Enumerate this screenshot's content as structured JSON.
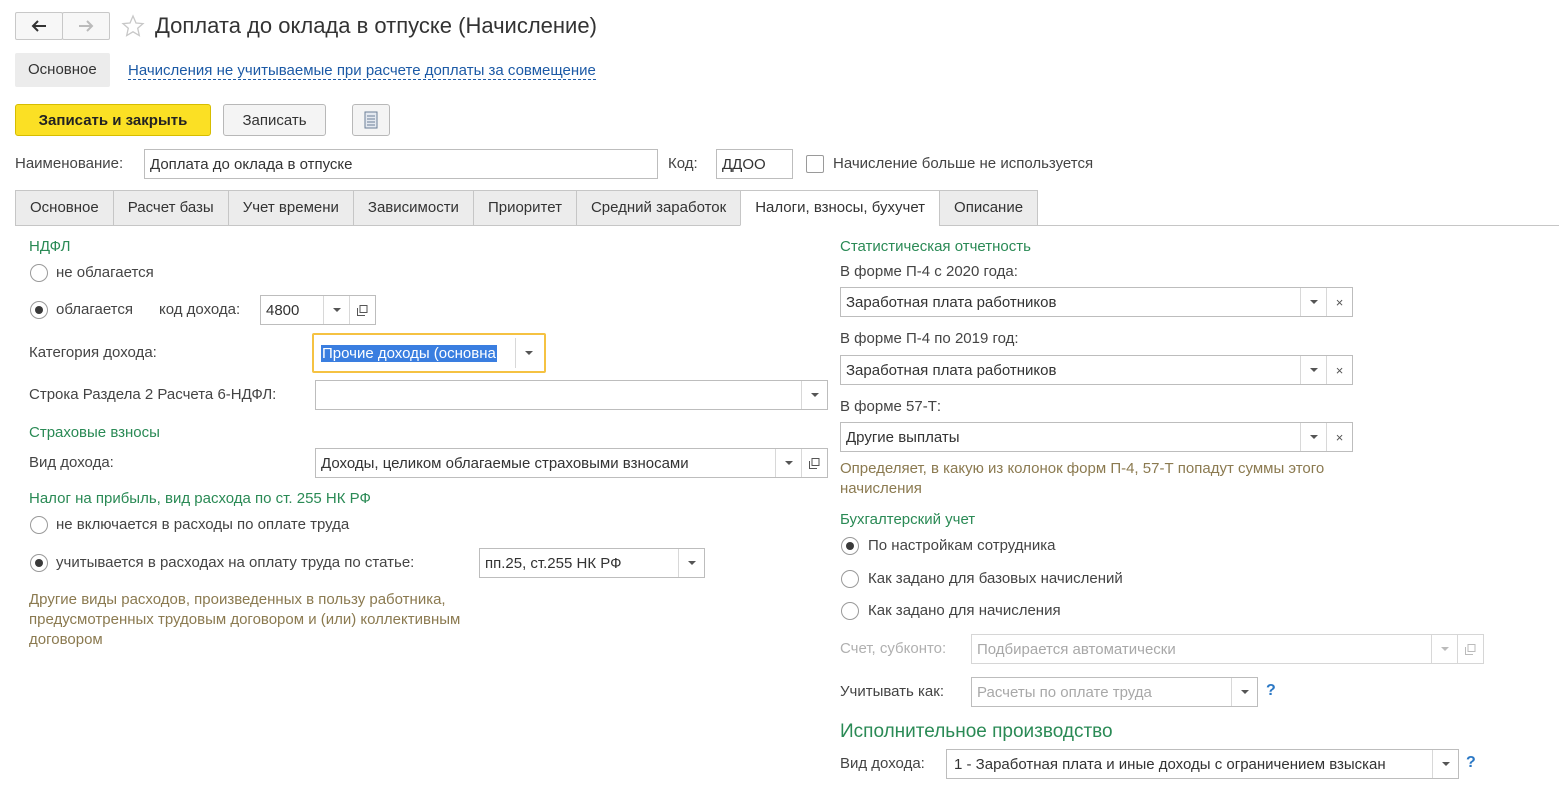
{
  "header": {
    "title": "Доплата до оклада в отпуске (Начисление)",
    "nav_chip": "Основное",
    "nav_link": "Начисления не учитываемые при расчете доплаты за совмещение"
  },
  "toolbar": {
    "save_close": "Записать и закрыть",
    "save": "Записать"
  },
  "form": {
    "name_label": "Наименование:",
    "name_value": "Доплата до оклада в отпуске",
    "code_label": "Код:",
    "code_value": "ДДОО",
    "unused_label": "Начисление больше не используется"
  },
  "tabs": [
    "Основное",
    "Расчет базы",
    "Учет времени",
    "Зависимости",
    "Приоритет",
    "Средний заработок",
    "Налоги, взносы, бухучет",
    "Описание"
  ],
  "ndfl": {
    "section": "НДФЛ",
    "not_taxed": "не облагается",
    "taxed": "облагается",
    "income_code_label": "код дохода:",
    "income_code_value": "4800",
    "category_label": "Категория дохода:",
    "category_value": "Прочие доходы (основна",
    "line_label": "Строка Раздела 2 Расчета 6-НДФЛ:",
    "line_value": ""
  },
  "insurance": {
    "section": "Страховые взносы",
    "income_type_label": "Вид дохода:",
    "income_type_value": "Доходы, целиком облагаемые страховыми взносами"
  },
  "profit_tax": {
    "section": "Налог на прибыль, вид расхода по ст. 255 НК РФ",
    "not_included": "не включается в расходы по оплате труда",
    "included": "учитывается в расходах на оплату труда по статье:",
    "article_value": "пп.25, ст.255 НК РФ",
    "hint": "Другие виды расходов, произведенных в пользу работника, предусмотренных трудовым договором и (или) коллективным договором"
  },
  "stats": {
    "section": "Статистическая отчетность",
    "p4_2020_label": "В форме П-4 с 2020 года:",
    "p4_2020_value": "Заработная плата работников",
    "p4_2019_label": "В форме П-4 по 2019 год:",
    "p4_2019_value": "Заработная плата работников",
    "f57t_label": "В форме 57-Т:",
    "f57t_value": "Другие выплаты",
    "hint": "Определяет, в какую из колонок форм П-4, 57-Т попадут суммы этого начисления"
  },
  "accounting": {
    "section": "Бухгалтерский учет",
    "opt_employee": "По настройкам сотрудника",
    "opt_base": "Как задано для базовых начислений",
    "opt_accrual": "Как задано для начисления",
    "account_label": "Счет, субконто:",
    "account_value": "Подбирается автоматически",
    "account_as_label": "Учитывать как:",
    "account_as_value": "Расчеты по оплате труда",
    "help": "?"
  },
  "enforcement": {
    "section": "Исполнительное производство",
    "income_type_label": "Вид дохода:",
    "income_type_value": "1 - Заработная плата и иные доходы с ограничением взыскан",
    "help": "?"
  }
}
